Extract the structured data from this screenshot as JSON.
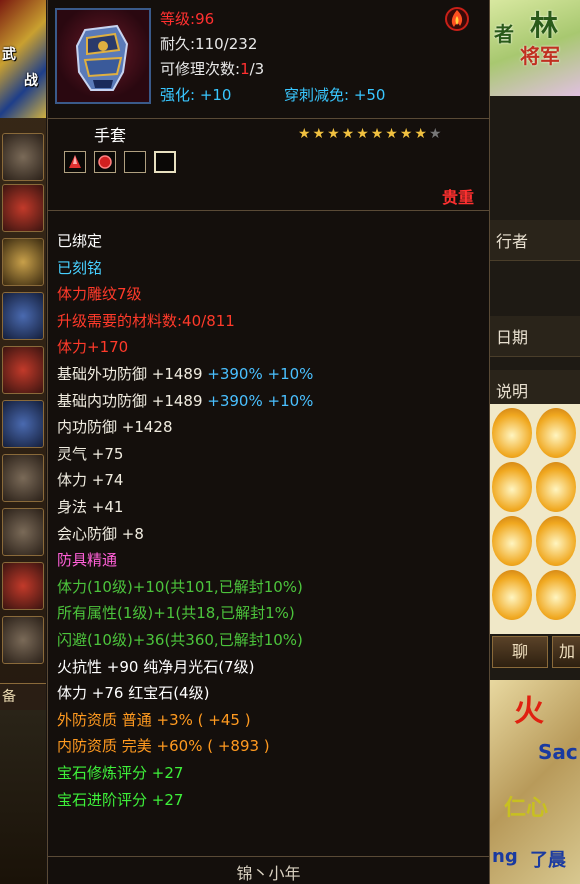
{
  "left_panel": {
    "banner_text_1": "武",
    "banner_text_2": "战",
    "tab_label": "备"
  },
  "right_panel": {
    "banner_text_1": "者",
    "banner_text_2": "林",
    "banner_text_3": "将军",
    "label_traveler": "行者",
    "label_date": "日期",
    "label_desc": "说明",
    "chat_button": "聊",
    "plus_button": "加",
    "scene_text_1": "火",
    "scene_text_2": "Sac",
    "scene_text_3": "仁心",
    "scene_text_4": "ng",
    "scene_text_5": "了晨"
  },
  "item": {
    "icon": "gauntlet-icon",
    "level_label": "等级",
    "level_value": ":96",
    "durability": "耐久:110/232",
    "repair_label": "可修理次数:",
    "repair_current": "1",
    "repair_total": "/3",
    "enhance": "强化: +10",
    "pierce": "穿刺减免: +50",
    "category": "手套",
    "stars_filled": "★★★★★★★★★",
    "stars_empty": "★",
    "rarity": "贵重",
    "attributes": [
      {
        "text": "已绑定",
        "color": "white"
      },
      {
        "text": "已刻铭",
        "color": "cyan"
      },
      {
        "text": "体力雕纹7级",
        "color": "red"
      },
      {
        "text": "升级需要的材料数:40/811",
        "color": "red"
      },
      {
        "text": "体力+170",
        "color": "red"
      },
      {
        "text": "基础外功防御 +1489 ",
        "extra": "+390% +10%",
        "color": "lwhite"
      },
      {
        "text": "基础内功防御 +1489 ",
        "extra": "+390% +10%",
        "color": "lwhite"
      },
      {
        "text": "内功防御 +1428",
        "color": "lwhite"
      },
      {
        "text": "灵气 +75",
        "color": "lwhite"
      },
      {
        "text": "体力 +74",
        "color": "lwhite"
      },
      {
        "text": "身法 +41",
        "color": "lwhite"
      },
      {
        "text": "会心防御 +8",
        "color": "lwhite"
      },
      {
        "text": "防具精通",
        "color": "pink"
      },
      {
        "text": "体力(10级)+10(共101,已解封10%)",
        "color": "green"
      },
      {
        "text": "所有属性(1级)+1(共18,已解封1%)",
        "color": "green"
      },
      {
        "text": "闪避(10级)+36(共360,已解封10%)",
        "color": "green"
      },
      {
        "text": "火抗性 +90 纯净月光石(7级)",
        "color": "white"
      },
      {
        "text": "体力 +76 红宝石(4级)",
        "color": "white"
      },
      {
        "text": "外防资质  普通 +3% ( +45 )",
        "color": "orange"
      },
      {
        "text": "内防资质  完美 +60% ( +893 )",
        "color": "orange"
      },
      {
        "text": "宝石修炼评分 +27",
        "color": "brgreen"
      },
      {
        "text": "宝石进阶评分 +27",
        "color": "brgreen"
      }
    ],
    "footer": "锦丶小年"
  },
  "colors": {
    "level_red": "#ff3030",
    "enhance_blue": "#39c7ff",
    "green_attr": "#4cc43c",
    "orange_attr": "#ff9a20",
    "pink_attr": "#ff60d8"
  }
}
